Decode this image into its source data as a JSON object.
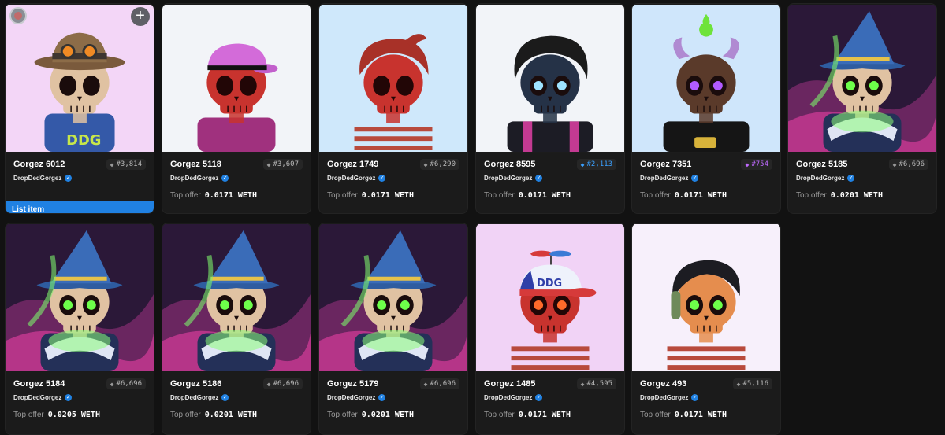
{
  "actions": {
    "list_item_label": "List item",
    "add_icon": "plus-icon"
  },
  "top_offer_label": "Top offer",
  "items": [
    {
      "name": "Gorgez 6012",
      "collection": "DropDedGorgez",
      "rank": "#3,814",
      "rank_color": "gray",
      "offer": "",
      "bg": "#f3d6f7",
      "style": "hat"
    },
    {
      "name": "Gorgez 5118",
      "collection": "DropDedGorgez",
      "rank": "#3,607",
      "rank_color": "gray",
      "offer": "0.0171 WETH",
      "bg": "#f2f4f8",
      "style": "cap"
    },
    {
      "name": "Gorgez 1749",
      "collection": "DropDedGorgez",
      "rank": "#6,290",
      "rank_color": "gray",
      "offer": "0.0171 WETH",
      "bg": "#cfe8fb",
      "style": "hair-red"
    },
    {
      "name": "Gorgez 8595",
      "collection": "DropDedGorgez",
      "rank": "#2,113",
      "rank_color": "blue",
      "offer": "0.0171 WETH",
      "bg": "#f2f4f8",
      "style": "pompadour"
    },
    {
      "name": "Gorgez 7351",
      "collection": "DropDedGorgez",
      "rank": "#754",
      "rank_color": "purple",
      "offer": "0.0171 WETH",
      "bg": "#cfe6fb",
      "style": "horns"
    },
    {
      "name": "Gorgez 5185",
      "collection": "DropDedGorgez",
      "rank": "#6,696",
      "rank_color": "gray",
      "offer": "0.0201 WETH",
      "bg": "#2a1a3a",
      "style": "wizard"
    },
    {
      "name": "Gorgez 5184",
      "collection": "DropDedGorgez",
      "rank": "#6,696",
      "rank_color": "gray",
      "offer": "0.0205 WETH",
      "bg": "#2a1a3a",
      "style": "wizard"
    },
    {
      "name": "Gorgez 5186",
      "collection": "DropDedGorgez",
      "rank": "#6,696",
      "rank_color": "gray",
      "offer": "0.0201 WETH",
      "bg": "#2a1a3a",
      "style": "wizard"
    },
    {
      "name": "Gorgez 5179",
      "collection": "DropDedGorgez",
      "rank": "#6,696",
      "rank_color": "gray",
      "offer": "0.0201 WETH",
      "bg": "#2a1a3a",
      "style": "wizard"
    },
    {
      "name": "Gorgez 1485",
      "collection": "DropDedGorgez",
      "rank": "#4,595",
      "rank_color": "gray",
      "offer": "0.0171 WETH",
      "bg": "#f1d3f6",
      "style": "propeller"
    },
    {
      "name": "Gorgez 493",
      "collection": "DropDedGorgez",
      "rank": "#5,116",
      "rank_color": "gray",
      "offer": "0.0171 WETH",
      "bg": "#f7f0fb",
      "style": "green-eyes"
    }
  ]
}
